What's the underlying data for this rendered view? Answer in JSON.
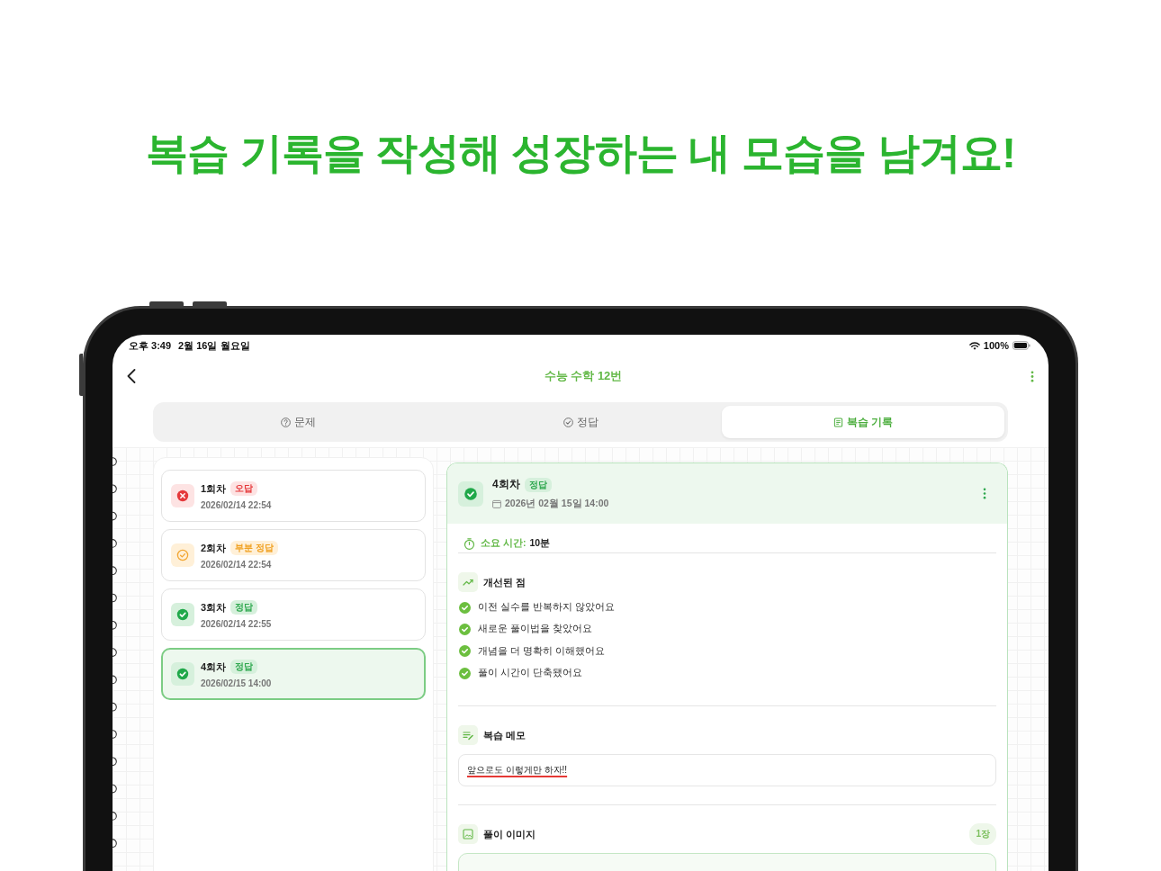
{
  "headline": "복습 기록을 작성해 성장하는 내 모습을 남겨요!",
  "status_bar": {
    "time": "오후 3:49",
    "date": "2월 16일 월요일",
    "battery": "100%"
  },
  "nav_bar": {
    "title": "수능 수학 12번"
  },
  "tabs": [
    {
      "label": "문제",
      "selected": false
    },
    {
      "label": "정답",
      "selected": false
    },
    {
      "label": "복습 기록",
      "selected": true
    }
  ],
  "attempts": [
    {
      "title": "1회차",
      "kind": "wrong",
      "result": "오답",
      "date": "2026/02/14 22:54",
      "selected": false
    },
    {
      "title": "2회차",
      "kind": "partial",
      "result": "부분 정답",
      "date": "2026/02/14 22:54",
      "selected": false
    },
    {
      "title": "3회차",
      "kind": "correct",
      "result": "정답",
      "date": "2026/02/14 22:55",
      "selected": false
    },
    {
      "title": "4회차",
      "kind": "correct",
      "result": "정답",
      "date": "2026/02/15 14:00",
      "selected": true
    }
  ],
  "detail": {
    "title": "4회차",
    "kind": "correct",
    "result": "정답",
    "date": "2026년 02월 15일 14:00",
    "time_label": "소요 시간:",
    "time_value": "10분",
    "sections": [
      {
        "kind": "checklist",
        "title": "개선된 점",
        "items": [
          "이전 실수를 반복하지 않았어요",
          "새로운 풀이법을 찾았어요",
          "개념을 더 명확히 이해했어요",
          "풀이 시간이 단축됐어요"
        ]
      },
      {
        "kind": "memo",
        "title": "복습 메모",
        "memo": "앞으로도 이렇게만 하자!!"
      },
      {
        "kind": "images",
        "title": "풀이 이미지",
        "count": "1장"
      }
    ]
  }
}
